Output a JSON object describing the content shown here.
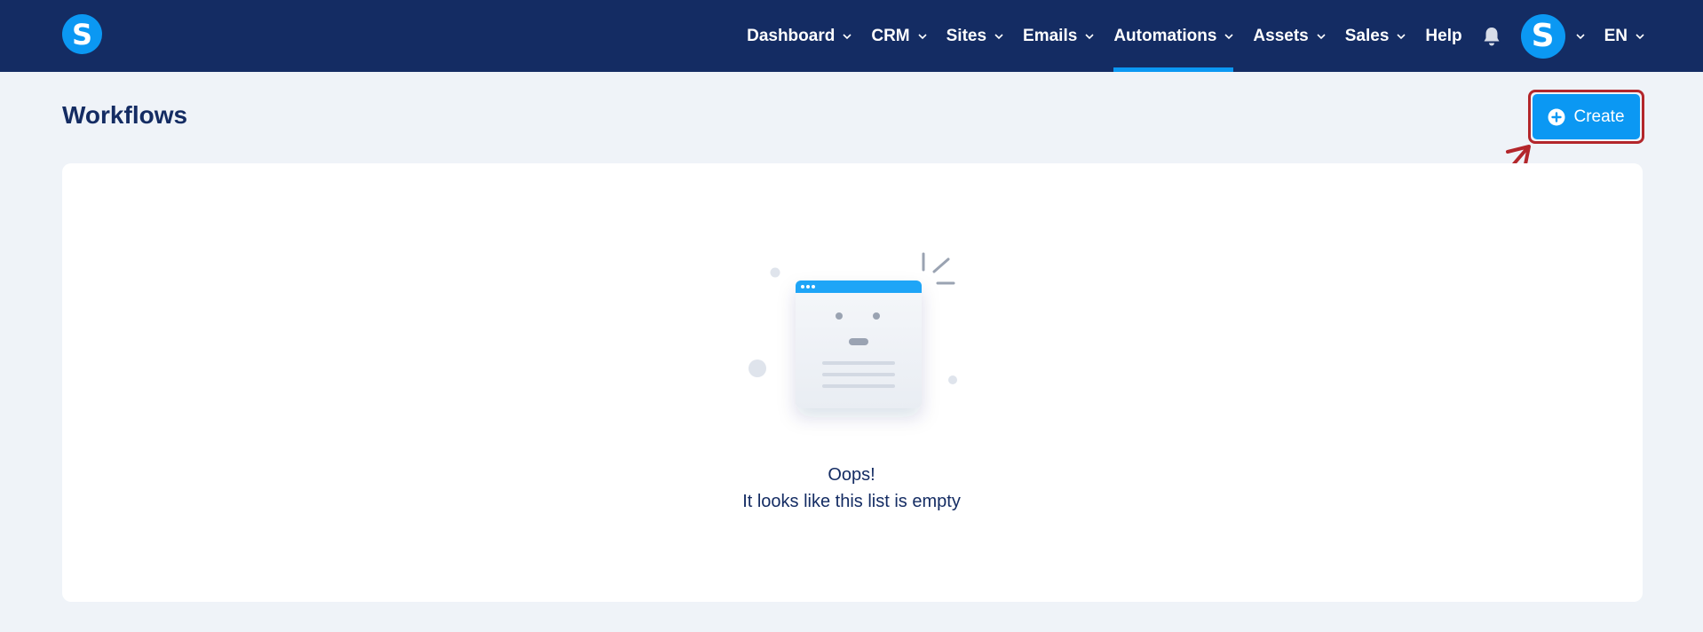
{
  "brand": {
    "logo_letter": "S"
  },
  "nav": {
    "items": [
      {
        "label": "Dashboard",
        "has_dropdown": true,
        "active": false
      },
      {
        "label": "CRM",
        "has_dropdown": true,
        "active": false
      },
      {
        "label": "Sites",
        "has_dropdown": true,
        "active": false
      },
      {
        "label": "Emails",
        "has_dropdown": true,
        "active": false
      },
      {
        "label": "Automations",
        "has_dropdown": true,
        "active": true
      },
      {
        "label": "Assets",
        "has_dropdown": true,
        "active": false
      },
      {
        "label": "Sales",
        "has_dropdown": true,
        "active": false
      },
      {
        "label": "Help",
        "has_dropdown": false,
        "active": false
      }
    ],
    "avatar_letter": "S",
    "language": "EN"
  },
  "page": {
    "title": "Workflows",
    "create_label": "Create"
  },
  "empty_state": {
    "title": "Oops!",
    "message": "It looks like this list is empty"
  },
  "colors": {
    "nav_bg": "#142c63",
    "accent": "#0b98f3",
    "page_bg": "#eff3f8",
    "annotation": "#b3262b"
  },
  "icons": [
    "bell-icon",
    "chevron-down-icon",
    "plus-circle-icon",
    "empty-list-illustration"
  ]
}
